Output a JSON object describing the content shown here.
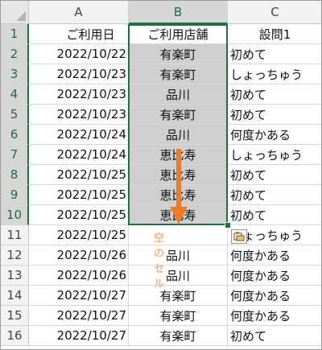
{
  "columns": [
    {
      "name": "A"
    },
    {
      "name": "B"
    },
    {
      "name": "C"
    }
  ],
  "rows": [
    {
      "num": "1",
      "a": "ご利用日",
      "b": "ご利用店舗",
      "c": "設問1"
    },
    {
      "num": "2",
      "a": "2022/10/22",
      "b": "有楽町",
      "c": "初めて"
    },
    {
      "num": "3",
      "a": "2022/10/23",
      "b": "有楽町",
      "c": "しょっちゅう"
    },
    {
      "num": "4",
      "a": "2022/10/23",
      "b": "品川",
      "c": "初めて"
    },
    {
      "num": "5",
      "a": "2022/10/23",
      "b": "有楽町",
      "c": "初めて"
    },
    {
      "num": "6",
      "a": "2022/10/24",
      "b": "品川",
      "c": "何度かある"
    },
    {
      "num": "7",
      "a": "2022/10/24",
      "b": "恵比寿",
      "c": "しょっちゅう"
    },
    {
      "num": "8",
      "a": "2022/10/25",
      "b": "恵比寿",
      "c": "初めて"
    },
    {
      "num": "9",
      "a": "2022/10/25",
      "b": "恵比寿",
      "c": "初めて"
    },
    {
      "num": "10",
      "a": "2022/10/25",
      "b": "恵比寿",
      "c": "初めて"
    },
    {
      "num": "11",
      "a": "2022/10/25",
      "b": "",
      "c": "しょっちゅう"
    },
    {
      "num": "12",
      "a": "2022/10/26",
      "b": "品川",
      "c": "何度かある"
    },
    {
      "num": "13",
      "a": "2022/10/26",
      "b": "品川",
      "c": "何度かある"
    },
    {
      "num": "14",
      "a": "2022/10/27",
      "b": "有楽町",
      "c": "何度かある"
    },
    {
      "num": "15",
      "a": "2022/10/27",
      "b": "有楽町",
      "c": "何度かある"
    },
    {
      "num": "16",
      "a": "2022/10/27",
      "b": "有楽町",
      "c": "初めて"
    }
  ],
  "selection": {
    "column": "B",
    "rows": "1-10"
  },
  "annotation": {
    "text": "空のセル"
  },
  "icons": {
    "quick_analysis": "quick-analysis-icon",
    "arrow": "down-arrow-icon"
  },
  "colors": {
    "accent": "#1e7145",
    "selected_fill": "#cfcfcf",
    "annotation_arrow": "#f07b26",
    "annotation_text": "#f7b487"
  }
}
